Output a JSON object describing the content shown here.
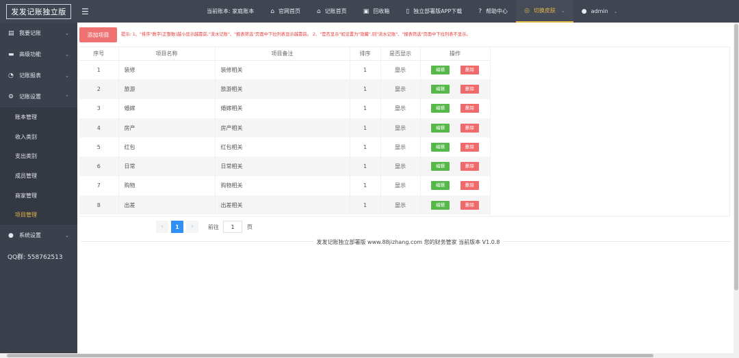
{
  "app": {
    "logo": "发发记账独立版"
  },
  "header": {
    "menu_icon": "menu-icon",
    "current_book": "当前账本: 家庭账本",
    "nav": [
      {
        "label": "官网首页",
        "icon": "home-icon"
      },
      {
        "label": "记账首页",
        "icon": "home-icon"
      },
      {
        "label": "回收箱",
        "icon": "trash-icon"
      },
      {
        "label": "独立部署版APP下载",
        "icon": "phone-icon"
      },
      {
        "label": "帮助中心",
        "icon": "help-icon"
      },
      {
        "label": "切换皮肤",
        "icon": "skin-icon"
      },
      {
        "label": "admin",
        "icon": "user-icon"
      }
    ]
  },
  "sidebar": {
    "items": [
      {
        "label": "我要记账",
        "icon": "book-icon"
      },
      {
        "label": "高级功能",
        "icon": "briefcase-icon"
      },
      {
        "label": "记账报表",
        "icon": "chart-icon"
      },
      {
        "label": "记账设置",
        "icon": "gear-icon"
      }
    ],
    "sub_items": [
      {
        "label": "账本管理"
      },
      {
        "label": "收入类别"
      },
      {
        "label": "支出类别"
      },
      {
        "label": "成员管理"
      },
      {
        "label": "商家管理"
      },
      {
        "label": "项目管理"
      }
    ],
    "system": {
      "label": "系统设置",
      "icon": "user-icon"
    },
    "qq": "QQ群:  558762513"
  },
  "toolbar": {
    "add_label": "添加项目",
    "tip": "提示:   1、\"排序\"数字(正整数)越小显示越靠前,\"流水记账\"、\"报表筛选\"页面中下拉列表显示越靠前。   2、\"是否显示\"如设置为\"隐藏\",则\"流水记账\"、\"报表筛选\"页面中下拉列表不显示。"
  },
  "table": {
    "headers": [
      "序号",
      "项目名称",
      "项目备注",
      "排序",
      "是否显示",
      "操作"
    ],
    "edit_label": "编辑",
    "delete_label": "删除",
    "rows": [
      {
        "no": "1",
        "name": "装修",
        "note": "装修相关",
        "sort": "1",
        "show": "显示"
      },
      {
        "no": "2",
        "name": "旅游",
        "note": "旅游相关",
        "sort": "1",
        "show": "显示"
      },
      {
        "no": "3",
        "name": "婚嫁",
        "note": "婚嫁相关",
        "sort": "1",
        "show": "显示"
      },
      {
        "no": "4",
        "name": "房产",
        "note": "房产相关",
        "sort": "1",
        "show": "显示"
      },
      {
        "no": "5",
        "name": "红包",
        "note": "红包相关",
        "sort": "1",
        "show": "显示"
      },
      {
        "no": "6",
        "name": "日常",
        "note": "日常相关",
        "sort": "1",
        "show": "显示"
      },
      {
        "no": "7",
        "name": "购物",
        "note": "购物相关",
        "sort": "1",
        "show": "显示"
      },
      {
        "no": "8",
        "name": "出差",
        "note": "出差相关",
        "sort": "1",
        "show": "显示"
      }
    ]
  },
  "pagination": {
    "prev": "‹",
    "current": "1",
    "next": "›",
    "goto_label": "前往",
    "goto_value": "1",
    "unit": "页"
  },
  "footer": {
    "text": "发发记账独立部署版   www.88jizhang.com   您的财务管家   当前版本 V1.0.8"
  }
}
